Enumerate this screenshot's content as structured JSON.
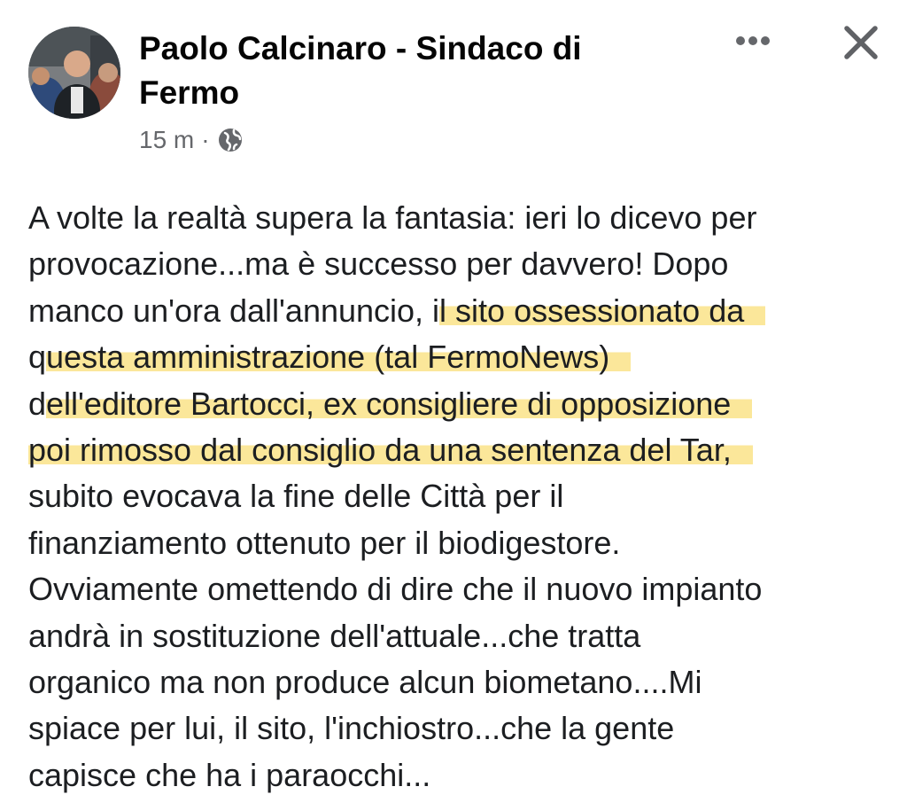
{
  "post": {
    "author": "Paolo Calcinaro - Sindaco di Fermo",
    "time": "15 m",
    "separator": "·",
    "privacy_icon": "globe-icon",
    "more_icon": "more-dots-icon",
    "close_icon": "close-icon",
    "highlight_color": "#fbe79a",
    "text_lines": [
      {
        "plain": "A volte la realtà supera la fantasia: ieri lo dicevo per",
        "highlight": ""
      },
      {
        "plain": "provocazione...ma è successo per davvero! Dopo",
        "highlight": ""
      },
      {
        "plain": "manco un'ora dall'annuncio, i",
        "highlight": "l sito ossessionato da"
      },
      {
        "plain": "q",
        "highlight": "uesta amministrazione (tal FermoNews)"
      },
      {
        "plain": "d",
        "highlight": "ell'editore Bartocci, ex consigliere di opposizione"
      },
      {
        "plain": "",
        "highlight": "poi rimosso dal consiglio da una sentenza del Tar,"
      },
      {
        "plain": "subito evocava la fine delle Città per il",
        "highlight": ""
      },
      {
        "plain": "finanziamento ottenuto per il biodigestore.",
        "highlight": ""
      },
      {
        "plain": "Ovviamente omettendo di dire che il nuovo impianto",
        "highlight": ""
      },
      {
        "plain": "andrà in sostituzione dell'attuale...che tratta",
        "highlight": ""
      },
      {
        "plain": "organico ma non produce alcun biometano....Mi",
        "highlight": ""
      },
      {
        "plain": "spiace per lui, il sito, l'inchiostro...che la gente",
        "highlight": ""
      },
      {
        "plain": "capisce che ha i paraocchi...",
        "highlight": ""
      }
    ]
  }
}
